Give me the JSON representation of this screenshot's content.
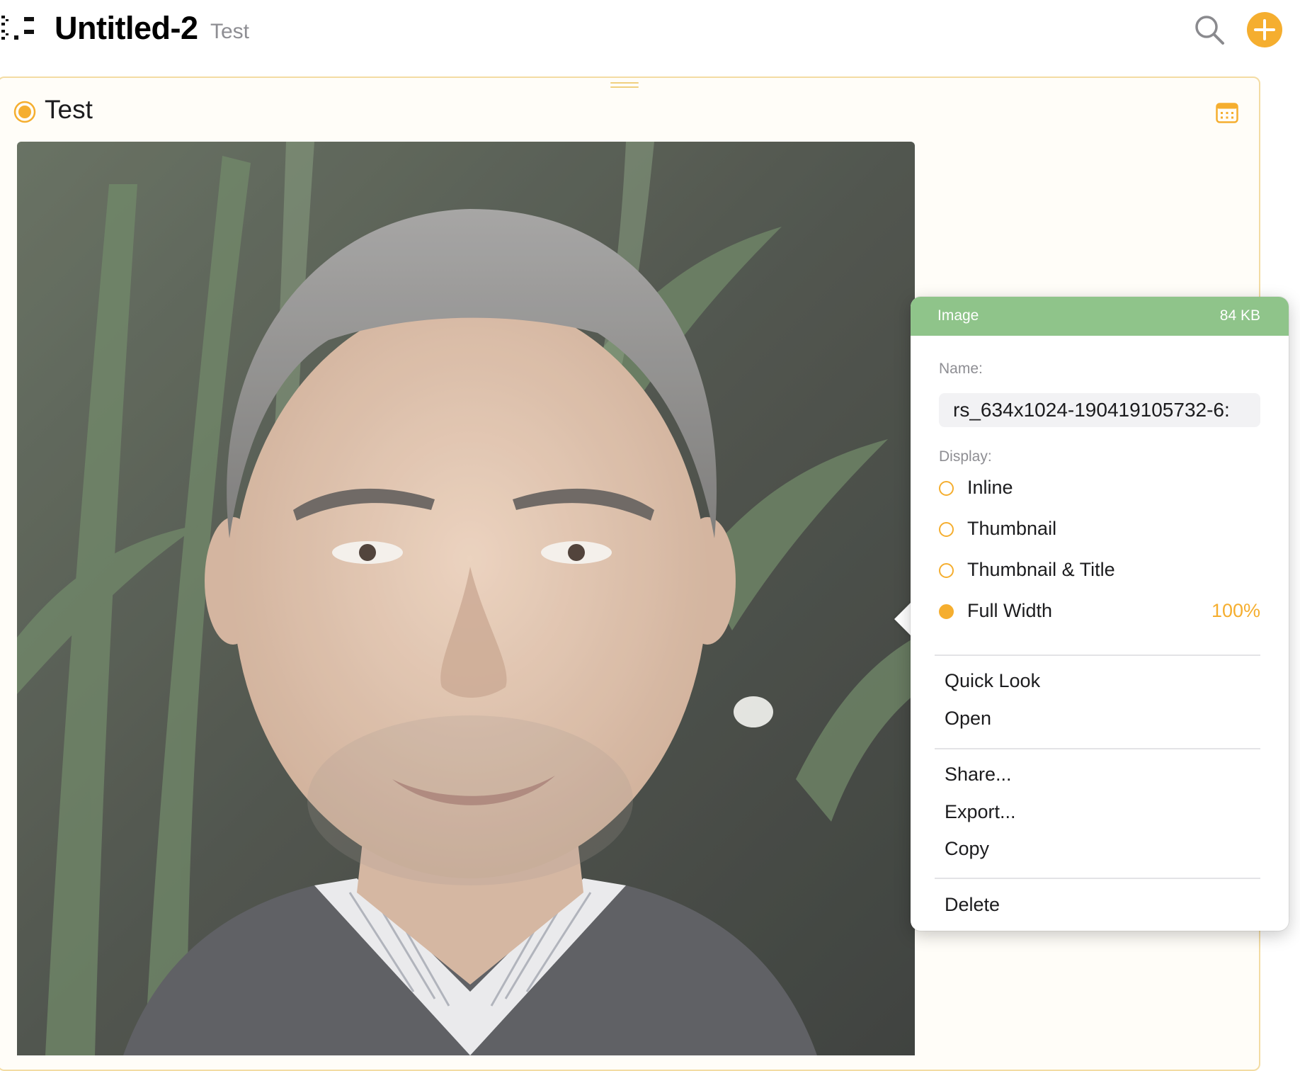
{
  "header": {
    "title": "Untitled-2",
    "subtitle": "Test",
    "icons": {
      "logo": "app-logo-icon",
      "search": "search-icon",
      "add": "plus-circle-icon"
    }
  },
  "note": {
    "title": "Test",
    "status": "in-progress",
    "icons": {
      "status": "status-dot-icon",
      "calendar": "calendar-icon",
      "drag": "drag-handle-icon"
    }
  },
  "image_inspector": {
    "type_label": "Image",
    "size": "84 KB",
    "name_label": "Name:",
    "name_value": "rs_634x1024-190419105732-6:",
    "display_label": "Display:",
    "display_options": [
      {
        "label": "Inline",
        "selected": false
      },
      {
        "label": "Thumbnail",
        "selected": false
      },
      {
        "label": "Thumbnail & Title",
        "selected": false
      },
      {
        "label": "Full Width",
        "selected": true,
        "value": "100%"
      }
    ],
    "actions": {
      "quick_look": "Quick Look",
      "open": "Open",
      "share": "Share...",
      "export": "Export...",
      "copy": "Copy",
      "delete": "Delete"
    }
  },
  "colors": {
    "accent": "#f5ae2f",
    "inspector_header": "#8fc48a",
    "card_border": "#f3dca3",
    "card_background": "#fffdf8"
  }
}
